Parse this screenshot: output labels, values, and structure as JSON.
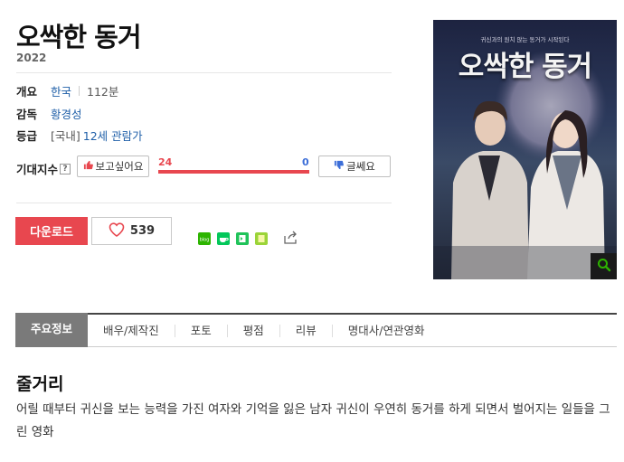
{
  "movie": {
    "title": "오싹한 동거",
    "year": "2022"
  },
  "info": {
    "overview_label": "개요",
    "country": "한국",
    "runtime": "112분",
    "director_label": "감독",
    "director": "황경성",
    "rating_label": "등급",
    "rating_prefix": "[국내]",
    "rating": "12세 관람가"
  },
  "expectation": {
    "label": "기대지수",
    "help": "?",
    "want_label": "보고싶어요",
    "want_count": "24",
    "meh_count": "0",
    "meh_label": "글쎄요",
    "want_ratio": 1.0
  },
  "actions": {
    "download_label": "다운로드",
    "like_count": "539"
  },
  "share_colors": {
    "blog": "#2db400",
    "cafe": "#03c75a",
    "band": "#20c35a",
    "memo": "#9bd438"
  },
  "poster": {
    "tagline": "귀신과의 원치 않는 동거가 시작된다",
    "title": "오싹한 동거"
  },
  "tabs": [
    {
      "label": "주요정보"
    },
    {
      "label": "배우/제작진"
    },
    {
      "label": "포토"
    },
    {
      "label": "평점"
    },
    {
      "label": "리뷰"
    },
    {
      "label": "명대사/연관영화"
    }
  ],
  "synopsis": {
    "heading": "줄거리",
    "text": "어릴 때부터 귀신을 보는 능력을 가진 여자와 기억을 잃은 남자 귀신이 우연히 동거를 하게 되면서 벌어지는 일들을 그린 영화"
  }
}
